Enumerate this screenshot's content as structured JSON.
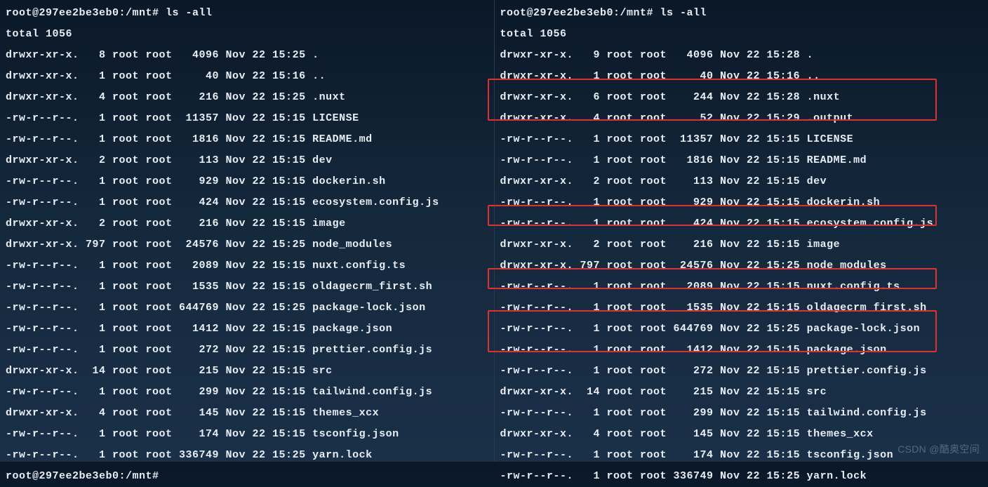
{
  "left": {
    "prompt": "root@297ee2be3eb0:/mnt# ls -all",
    "total": "total 1056",
    "entries": [
      "drwxr-xr-x.   8 root root   4096 Nov 22 15:25 .",
      "drwxr-xr-x.   1 root root     40 Nov 22 15:16 ..",
      "drwxr-xr-x.   4 root root    216 Nov 22 15:25 .nuxt",
      "-rw-r--r--.   1 root root  11357 Nov 22 15:15 LICENSE",
      "-rw-r--r--.   1 root root   1816 Nov 22 15:15 README.md",
      "drwxr-xr-x.   2 root root    113 Nov 22 15:15 dev",
      "-rw-r--r--.   1 root root    929 Nov 22 15:15 dockerin.sh",
      "-rw-r--r--.   1 root root    424 Nov 22 15:15 ecosystem.config.js",
      "drwxr-xr-x.   2 root root    216 Nov 22 15:15 image",
      "drwxr-xr-x. 797 root root  24576 Nov 22 15:25 node_modules",
      "-rw-r--r--.   1 root root   2089 Nov 22 15:15 nuxt.config.ts",
      "-rw-r--r--.   1 root root   1535 Nov 22 15:15 oldagecrm_first.sh",
      "-rw-r--r--.   1 root root 644769 Nov 22 15:25 package-lock.json",
      "-rw-r--r--.   1 root root   1412 Nov 22 15:15 package.json",
      "-rw-r--r--.   1 root root    272 Nov 22 15:15 prettier.config.js",
      "drwxr-xr-x.  14 root root    215 Nov 22 15:15 src",
      "-rw-r--r--.   1 root root    299 Nov 22 15:15 tailwind.config.js",
      "drwxr-xr-x.   4 root root    145 Nov 22 15:15 themes_xcx",
      "-rw-r--r--.   1 root root    174 Nov 22 15:15 tsconfig.json",
      "-rw-r--r--.   1 root root 336749 Nov 22 15:25 yarn.lock"
    ],
    "prompt_end": "root@297ee2be3eb0:/mnt# "
  },
  "right": {
    "prompt": "root@297ee2be3eb0:/mnt# ls -all",
    "total": "total 1056",
    "entries": [
      "drwxr-xr-x.   9 root root   4096 Nov 22 15:28 .",
      "drwxr-xr-x.   1 root root     40 Nov 22 15:16 ..",
      "drwxr-xr-x.   6 root root    244 Nov 22 15:28 .nuxt",
      "drwxr-xr-x.   4 root root     52 Nov 22 15:29 .output",
      "-rw-r--r--.   1 root root  11357 Nov 22 15:15 LICENSE",
      "-rw-r--r--.   1 root root   1816 Nov 22 15:15 README.md",
      "drwxr-xr-x.   2 root root    113 Nov 22 15:15 dev",
      "-rw-r--r--.   1 root root    929 Nov 22 15:15 dockerin.sh",
      "-rw-r--r--.   1 root root    424 Nov 22 15:15 ecosystem.config.js",
      "drwxr-xr-x.   2 root root    216 Nov 22 15:15 image",
      "drwxr-xr-x. 797 root root  24576 Nov 22 15:25 node_modules",
      "-rw-r--r--.   1 root root   2089 Nov 22 15:15 nuxt.config.ts",
      "-rw-r--r--.   1 root root   1535 Nov 22 15:15 oldagecrm_first.sh",
      "-rw-r--r--.   1 root root 644769 Nov 22 15:25 package-lock.json",
      "-rw-r--r--.   1 root root   1412 Nov 22 15:15 package.json",
      "-rw-r--r--.   1 root root    272 Nov 22 15:15 prettier.config.js",
      "drwxr-xr-x.  14 root root    215 Nov 22 15:15 src",
      "-rw-r--r--.   1 root root    299 Nov 22 15:15 tailwind.config.js",
      "drwxr-xr-x.   4 root root    145 Nov 22 15:15 themes_xcx",
      "-rw-r--r--.   1 root root    174 Nov 22 15:15 tsconfig.json",
      "-rw-r--r--.   1 root root 336749 Nov 22 15:25 yarn.lock"
    ]
  },
  "watermark": "CSDN @酷奥空间"
}
